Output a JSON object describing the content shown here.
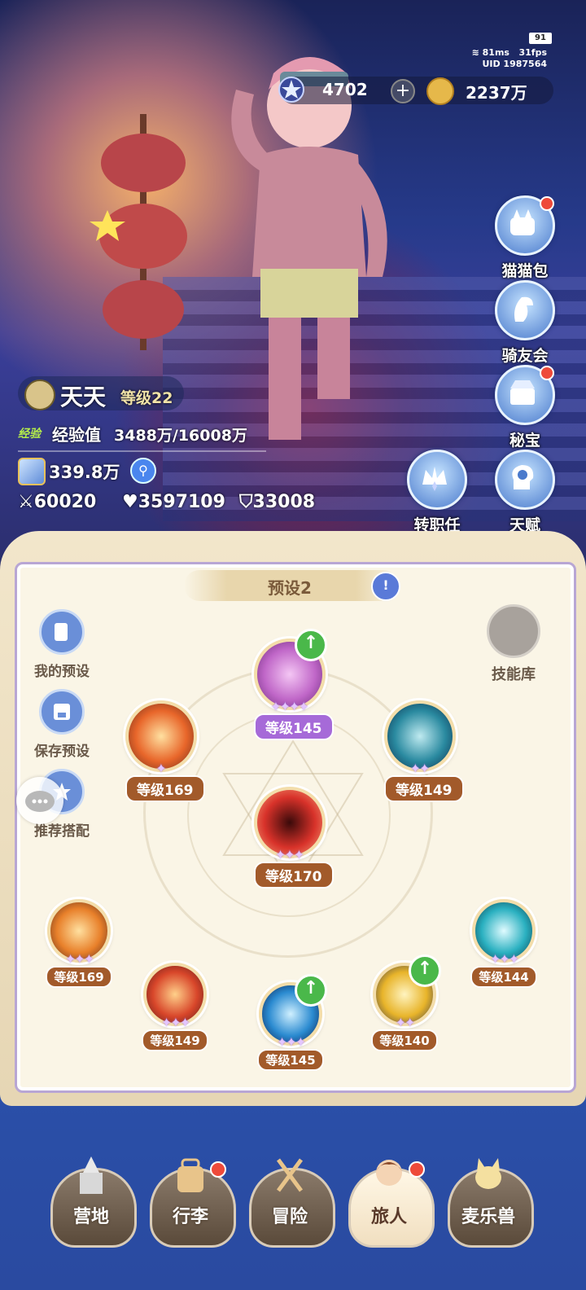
{
  "status": {
    "battery": "91",
    "ping": "81ms",
    "fps": "31fps",
    "uid": "UID 1987564"
  },
  "currency": {
    "gems": "4702",
    "gold": "2237万"
  },
  "side_menu": [
    {
      "label": "猫猫包",
      "icon": "cat-bag-icon",
      "badge": true
    },
    {
      "label": "骑友会",
      "icon": "horse-icon",
      "badge": false
    },
    {
      "label": "秘宝",
      "icon": "treasure-icon",
      "badge": true
    },
    {
      "label": "转职任务",
      "icon": "crown-icon",
      "badge": false
    },
    {
      "label": "天赋",
      "icon": "brain-icon",
      "badge": false
    }
  ],
  "player": {
    "name": "天天",
    "level": "等级22",
    "exp_tag": "经验",
    "exp_label": "经验值",
    "exp_value": "3488万/16008万",
    "power": "339.8万",
    "attack": "60020",
    "hp": "3597109",
    "defense": "33008"
  },
  "preset": {
    "title": "预设2"
  },
  "left_buttons": [
    {
      "label": "我的预设",
      "icon": "presets-icon"
    },
    {
      "label": "保存预设",
      "icon": "save-icon"
    },
    {
      "label": "推荐搭配",
      "icon": "recommend-icon"
    }
  ],
  "skill_library": {
    "label": "技能库"
  },
  "skills": [
    {
      "level": "等级145",
      "stars": "✦✦✦✦",
      "color": "#c067c8",
      "upgrade": true
    },
    {
      "level": "等级169",
      "stars": "✦",
      "color": "#e8662a",
      "upgrade": false
    },
    {
      "level": "等级149",
      "stars": "✦✦",
      "color": "#2a8aa0",
      "upgrade": false
    },
    {
      "level": "等级170",
      "stars": "✦✦✦",
      "color": "#d8322a",
      "upgrade": false
    },
    {
      "level": "等级169",
      "stars": "✦✦✦",
      "color": "#e8802a",
      "upgrade": false
    },
    {
      "level": "等级149",
      "stars": "✦✦✦",
      "color": "#d8462a",
      "upgrade": false
    },
    {
      "level": "等级145",
      "stars": "✦✦✦",
      "color": "#2a8ad0",
      "upgrade": true
    },
    {
      "level": "等级140",
      "stars": "✦✦",
      "color": "#e8b42a",
      "upgrade": true
    },
    {
      "level": "等级144",
      "stars": "✦✦✦",
      "color": "#2ab0c0",
      "upgrade": false
    }
  ],
  "nav": [
    {
      "label": "营地",
      "icon": "castle-icon",
      "badge": false,
      "active": false
    },
    {
      "label": "行李",
      "icon": "backpack-icon",
      "badge": true,
      "active": false
    },
    {
      "label": "冒险",
      "icon": "crossed-swords-icon",
      "badge": false,
      "active": false
    },
    {
      "label": "旅人",
      "icon": "traveler-icon",
      "badge": true,
      "active": true
    },
    {
      "label": "麦乐兽",
      "icon": "cat-pet-icon",
      "badge": false,
      "active": false
    }
  ]
}
